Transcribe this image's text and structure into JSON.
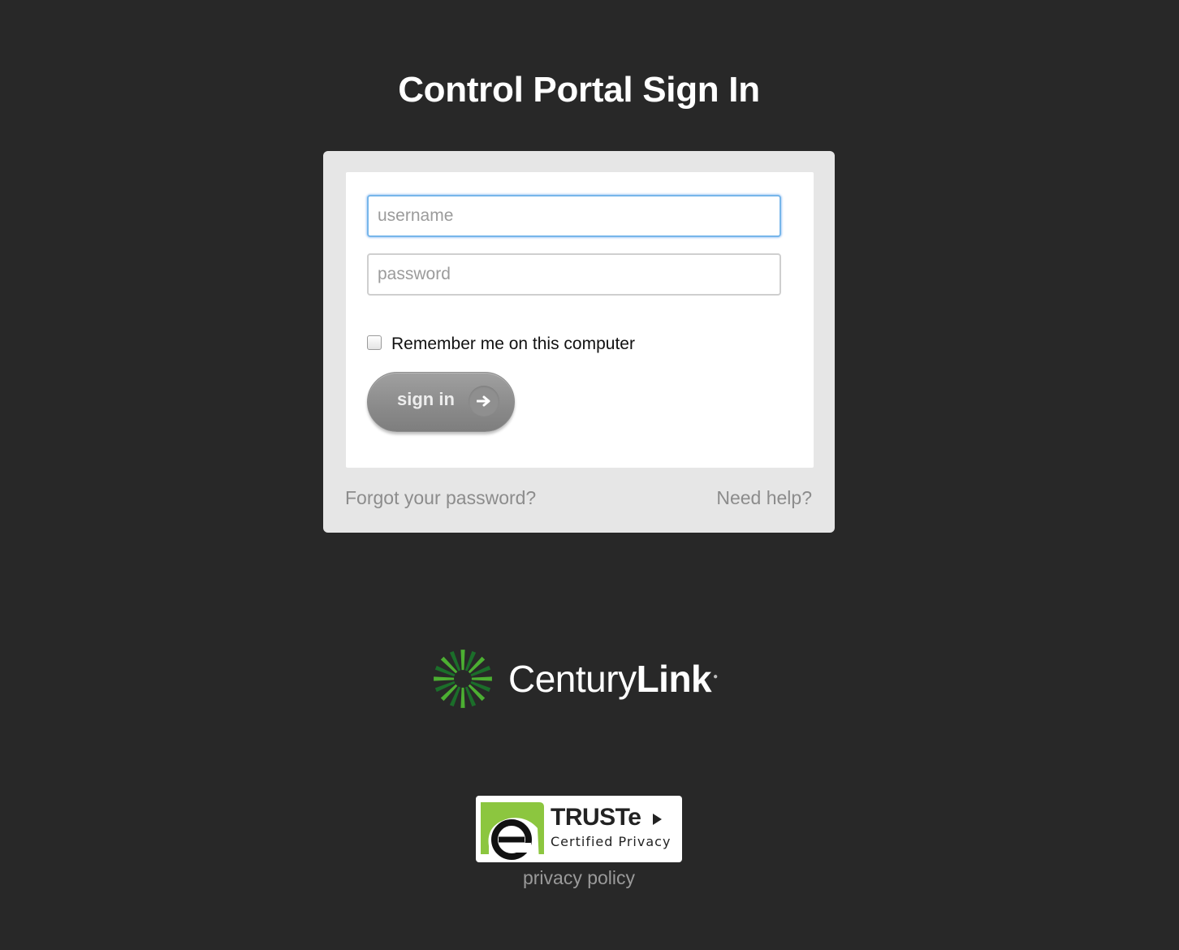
{
  "header": {
    "title": "Control Portal Sign In"
  },
  "login": {
    "username_placeholder": "username",
    "username_value": "",
    "password_placeholder": "password",
    "password_value": "",
    "remember_label": "Remember me on this computer",
    "remember_checked": false,
    "signin_label": "sign in",
    "signin_icon": "arrow-right-icon",
    "forgot_link": "Forgot your password?",
    "help_link": "Need help?"
  },
  "branding": {
    "logo_text_regular": "Century",
    "logo_text_bold": "Link",
    "logo_icon": "centurylink-starburst-icon",
    "logo_green": "#4caf32",
    "logo_dark_green": "#1b6e2a"
  },
  "footer": {
    "badge_title": "TRUSTe",
    "badge_subtitle": "Certified Privacy",
    "badge_icon": "truste-e-icon",
    "badge_green": "#8cc63f",
    "privacy_link": "privacy policy"
  },
  "colors": {
    "background": "#282828",
    "panel": "#e6e6e6",
    "focus_ring": "#77b6ea",
    "button_gray": "#8a8a8a"
  }
}
